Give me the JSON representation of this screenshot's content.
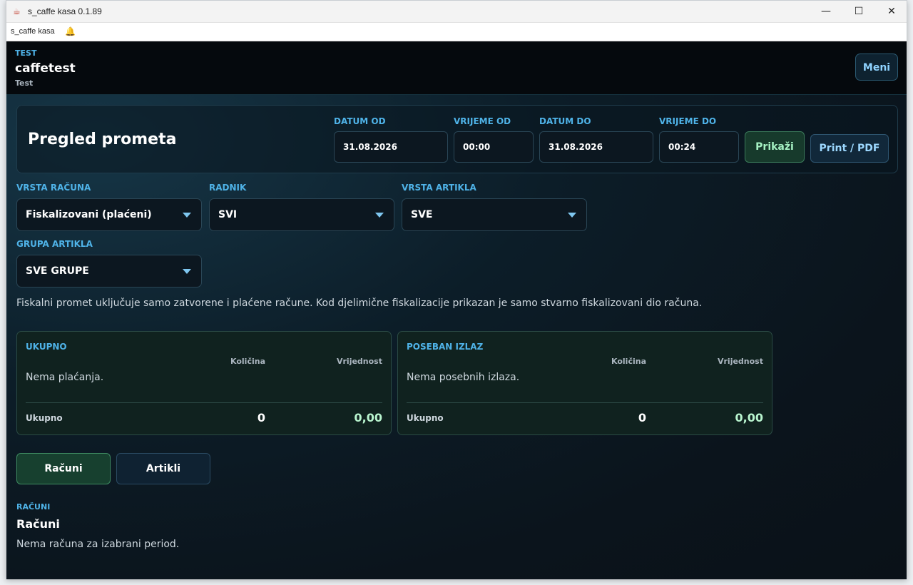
{
  "window": {
    "title": "s_caffe kasa 0.1.89",
    "tab_label": "s_caffe kasa",
    "controls": {
      "minimize": "—",
      "maximize": "☐",
      "close": "✕"
    }
  },
  "header": {
    "env_label": "TEST",
    "company": "caffetest",
    "subtitle": "Test",
    "menu_label": "Meni"
  },
  "filters": {
    "page_title": "Pregled prometa",
    "date_from": {
      "label": "DATUM OD",
      "value": "31.08.2026"
    },
    "time_from": {
      "label": "VRIJEME OD",
      "value": "00:00"
    },
    "date_to": {
      "label": "DATUM DO",
      "value": "31.08.2026"
    },
    "time_to": {
      "label": "VRIJEME DO",
      "value": "00:24"
    },
    "show_label": "Prikaži",
    "print_label": "Print / PDF"
  },
  "selects": {
    "receipt_type": {
      "label": "VRSTA RAČUNA",
      "value": "Fiskalizovani (plaćeni)"
    },
    "worker": {
      "label": "RADNIK",
      "value": "SVI"
    },
    "item_type": {
      "label": "VRSTA ARTIKLA",
      "value": "SVE"
    },
    "item_group": {
      "label": "GRUPA ARTIKLA",
      "value": "SVE GRUPE"
    }
  },
  "info_text": "Fiskalni promet uključuje samo zatvorene i plaćene račune. Kod djelimične fiskalizacije prikazan je samo stvarno fiskalizovani dio računa.",
  "summary": {
    "total": {
      "title": "UKUPNO",
      "qty_header": "Količina",
      "value_header": "Vrijednost",
      "empty": "Nema plaćanja.",
      "total_label": "Ukupno",
      "total_qty": "0",
      "total_value": "0,00"
    },
    "special": {
      "title": "POSEBAN IZLAZ",
      "qty_header": "Količina",
      "value_header": "Vrijednost",
      "empty": "Nema posebnih izlaza.",
      "total_label": "Ukupno",
      "total_qty": "0",
      "total_value": "0,00"
    }
  },
  "views": {
    "receipts": "Računi",
    "items": "Artikli"
  },
  "section": {
    "kicker": "RAČUNI",
    "title": "Računi",
    "empty": "Nema računa za izabrani period."
  },
  "colors": {
    "accent": "#4fb3e8",
    "success": "#a6f2c4",
    "background": "#0b141c"
  },
  "icons": {
    "app": "coffee-icon",
    "notification": "bell-icon",
    "dropdown": "chevron-down-icon"
  }
}
